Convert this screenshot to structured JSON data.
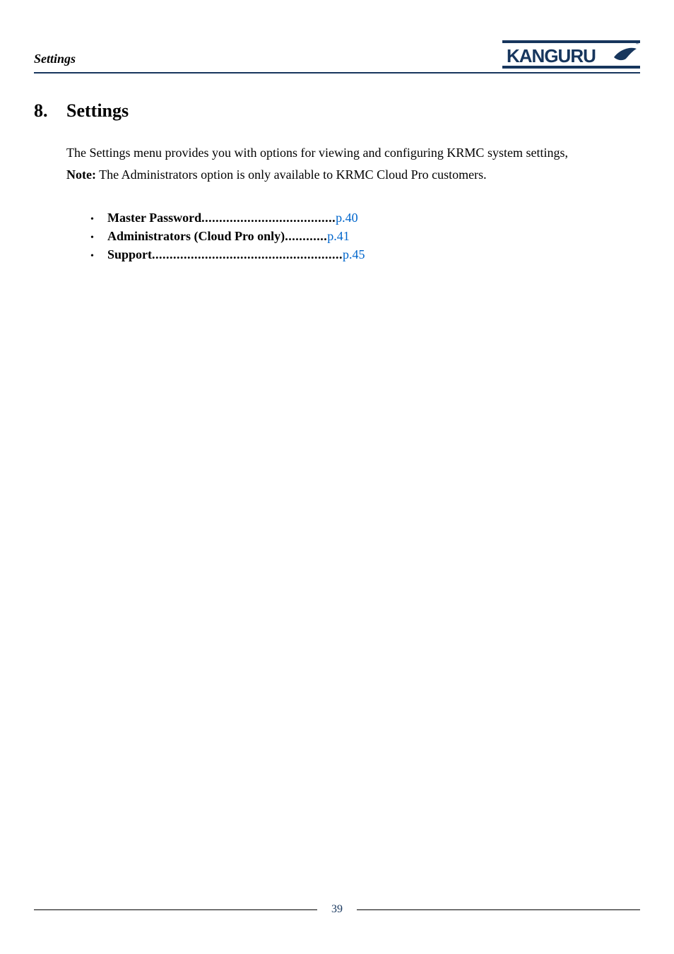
{
  "header": {
    "running_title": "Settings",
    "logo_text": "KANGURU"
  },
  "section": {
    "number": "8.",
    "title": "Settings"
  },
  "body": {
    "paragraph": "The Settings menu provides you with options for viewing and configuring KRMC system settings,",
    "note_label": "Note:",
    "note_text": " The Administrators option is only available to KRMC Cloud Pro customers."
  },
  "toc": [
    {
      "label": "Master Password",
      "page": "p.40"
    },
    {
      "label": "Administrators (Cloud Pro only)",
      "page": "p.41"
    },
    {
      "label": "Support",
      "page": "p.45"
    }
  ],
  "footer": {
    "page_number": "39"
  }
}
